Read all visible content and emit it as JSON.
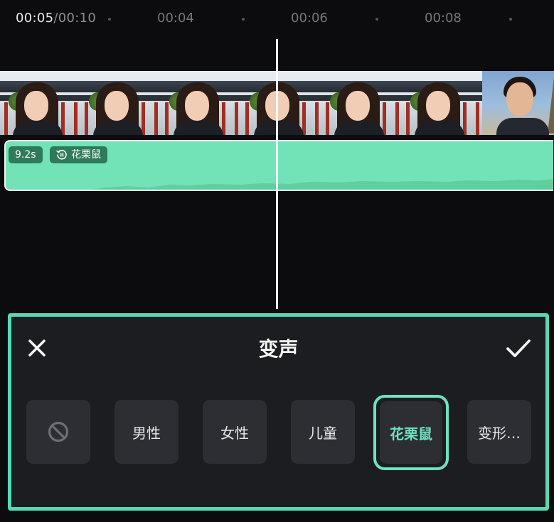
{
  "timeline": {
    "current_time": "00:05",
    "total_time": "/00:10",
    "ticks": [
      "00:04",
      "00:06",
      "00:08"
    ]
  },
  "audio_clip": {
    "duration_badge": "9.2s",
    "effect_badge": "花栗鼠",
    "effect_icon": "voice-change-icon",
    "color": "#72e3b7"
  },
  "panel": {
    "title": "变声",
    "close_icon": "close-icon",
    "confirm_icon": "check-icon",
    "accent_color": "#56d9b4",
    "options": [
      {
        "label": "",
        "icon": "none-icon"
      },
      {
        "label": "男性"
      },
      {
        "label": "女性"
      },
      {
        "label": "儿童"
      },
      {
        "label": "花栗鼠",
        "selected": true
      },
      {
        "label": "变形…"
      }
    ]
  }
}
